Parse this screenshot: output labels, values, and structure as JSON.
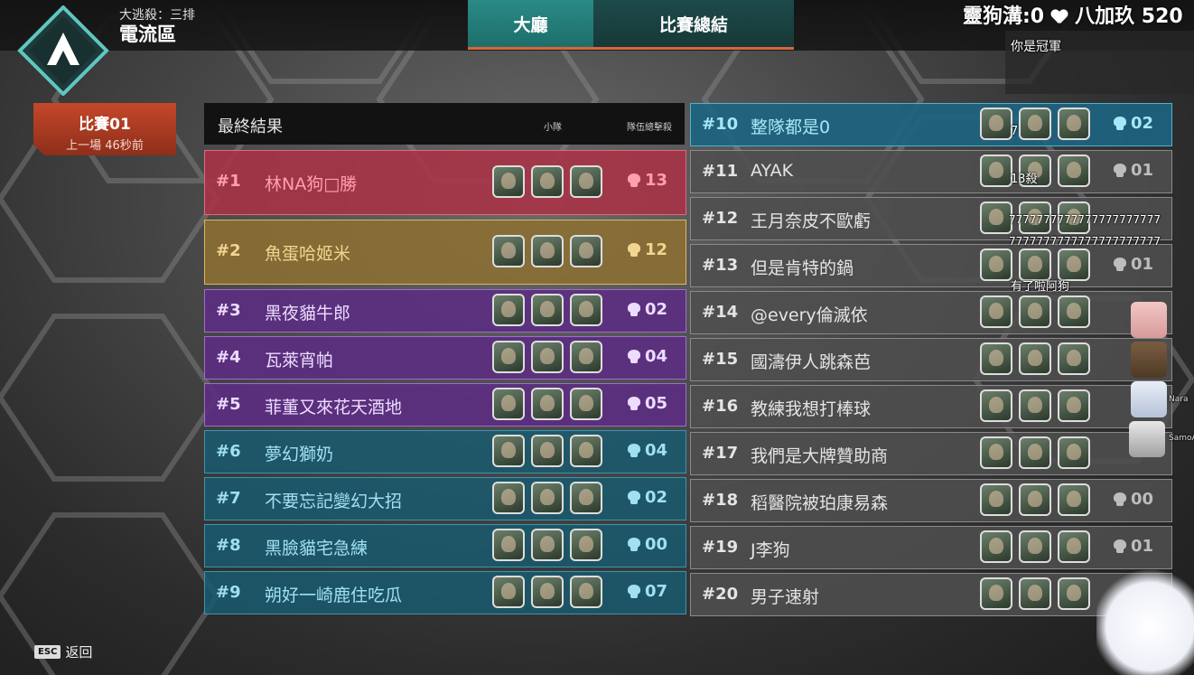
{
  "header": {
    "mode": "大逃殺：三排",
    "map": "電流區",
    "tabs": [
      {
        "label": "大廳",
        "active": true
      },
      {
        "label": "比賽總結",
        "active": false
      }
    ]
  },
  "match": {
    "label": "比賽01",
    "time": "上一場 46秒前"
  },
  "results": {
    "title": "最終結果",
    "col_squad": "小隊",
    "col_kills": "隊伍總擊殺"
  },
  "teams_left": [
    {
      "rank": "#1",
      "name": "林NA狗□勝",
      "kills": "13",
      "style": "red"
    },
    {
      "rank": "#2",
      "name": "魚蛋哈姬米",
      "kills": "12",
      "style": "gold"
    },
    {
      "rank": "#3",
      "name": "黑夜貓牛郎",
      "kills": "02",
      "style": "purple"
    },
    {
      "rank": "#4",
      "name": "瓦萊宵帕",
      "kills": "04",
      "style": "purple"
    },
    {
      "rank": "#5",
      "name": "菲董又來花天酒地",
      "kills": "05",
      "style": "purple"
    },
    {
      "rank": "#6",
      "name": "夢幻獅奶",
      "kills": "04",
      "style": "teal"
    },
    {
      "rank": "#7",
      "name": "不要忘記變幻大招",
      "kills": "02",
      "style": "teal"
    },
    {
      "rank": "#8",
      "name": "黑臉貓宅急練",
      "kills": "00",
      "style": "teal"
    },
    {
      "rank": "#9",
      "name": "朔好一崎鹿住吃瓜",
      "kills": "07",
      "style": "teal"
    }
  ],
  "teams_right": [
    {
      "rank": "#10",
      "name": "整隊都是0",
      "kills": "02",
      "style": "blueh"
    },
    {
      "rank": "#11",
      "name": "AYAK",
      "kills": "01",
      "style": "grey"
    },
    {
      "rank": "#12",
      "name": "王月奈皮不歐虧",
      "kills": "",
      "style": "grey"
    },
    {
      "rank": "#13",
      "name": "但是肯特的鍋",
      "kills": "01",
      "style": "grey"
    },
    {
      "rank": "#14",
      "name": "@every倫滅依",
      "kills": "",
      "style": "grey"
    },
    {
      "rank": "#15",
      "name": "國濤伊人跳森芭",
      "kills": "",
      "style": "grey"
    },
    {
      "rank": "#16",
      "name": "教練我想打棒球",
      "kills": "",
      "style": "grey"
    },
    {
      "rank": "#17",
      "name": "我們是大牌贊助商",
      "kills": "",
      "style": "grey"
    },
    {
      "rank": "#18",
      "name": "稻醫院被珀康易森",
      "kills": "00",
      "style": "grey"
    },
    {
      "rank": "#19",
      "name": "J李狗",
      "kills": "01",
      "style": "grey"
    },
    {
      "rank": "#20",
      "name": "男子速射",
      "kills": "",
      "style": "grey"
    }
  ],
  "footer": {
    "esc_key": "ESC",
    "back_label": "返回"
  },
  "stream": {
    "title_left": "靈狗溝:0",
    "title_right": "八加玖 520",
    "chat": [
      {
        "text": "你是冠軍"
      },
      {
        "text": "7"
      },
      {
        "text": "13殺"
      },
      {
        "text": "7777777777777777777777"
      },
      {
        "text": "7777777777777777777777"
      },
      {
        "text": "有了啦阿狗"
      }
    ],
    "viewers": [
      "Nara",
      "SamoAg"
    ]
  }
}
